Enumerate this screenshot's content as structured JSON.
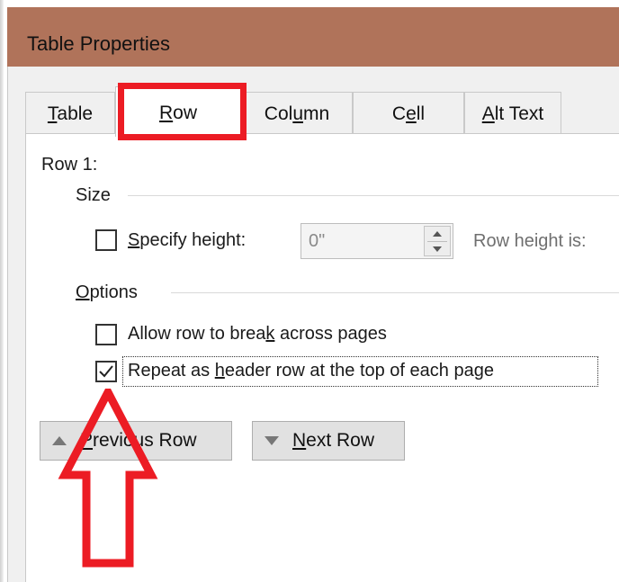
{
  "window": {
    "title": "Table Properties"
  },
  "tabs": [
    {
      "pre": "",
      "ul": "T",
      "post": "able"
    },
    {
      "pre": "",
      "ul": "R",
      "post": "ow"
    },
    {
      "pre": "Col",
      "ul": "u",
      "post": "mn"
    },
    {
      "pre": "C",
      "ul": "e",
      "post": "ll"
    },
    {
      "pre": "",
      "ul": "A",
      "post": "lt Text"
    }
  ],
  "active_tab": "Row",
  "row_panel": {
    "row_label": "Row 1:",
    "size_group": "Size",
    "specify_height": {
      "pre": "",
      "ul": "S",
      "post": "pecify height:",
      "checked": false
    },
    "height_value": "0\"",
    "row_height_is_label": "Row height is:",
    "options_group": {
      "pre": "",
      "ul": "O",
      "post": "ptions"
    },
    "allow_break": {
      "pre": "Allow row to brea",
      "ul": "k",
      "post": " across pages",
      "checked": false
    },
    "repeat_header": {
      "pre": "Repeat as ",
      "ul": "h",
      "post": "eader row at the top of each page",
      "checked": true
    }
  },
  "nav_buttons": {
    "previous": {
      "pre": "",
      "ul": "P",
      "post": "revious Row"
    },
    "next": {
      "pre": "",
      "ul": "N",
      "post": "ext Row"
    }
  },
  "colors": {
    "titlebar": "#b0735a",
    "annotation_red": "#ec1c24",
    "dialog_bg": "#f0f0f0"
  }
}
